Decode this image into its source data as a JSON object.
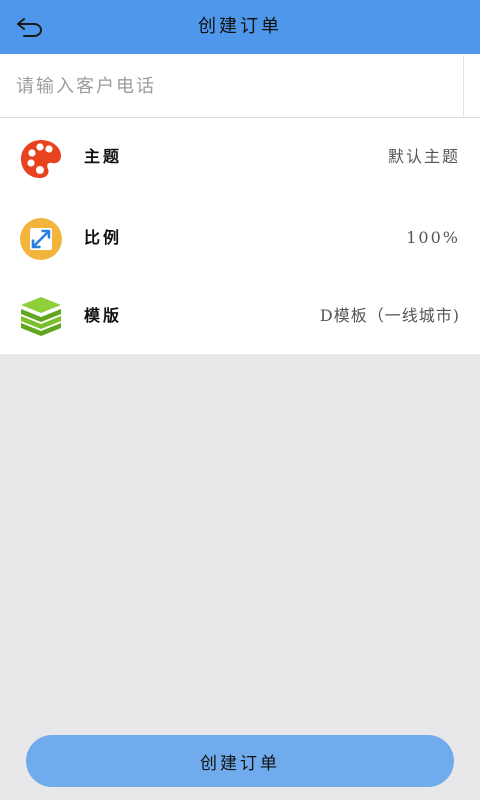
{
  "header": {
    "title": "创建订单",
    "back_icon": "undo-arrow-icon",
    "color": "#4f97ea"
  },
  "phone": {
    "placeholder": "请输入客户电话",
    "value": ""
  },
  "settings": [
    {
      "label": "主题",
      "value": "默认主题",
      "icon": "palette-icon"
    },
    {
      "label": "比例",
      "value": "100%",
      "icon": "resize-icon"
    },
    {
      "label": "模版",
      "value": "D模板（一线城市)",
      "icon": "layers-icon"
    }
  ],
  "submit": {
    "label": "创建订单",
    "color": "#6fabed"
  }
}
